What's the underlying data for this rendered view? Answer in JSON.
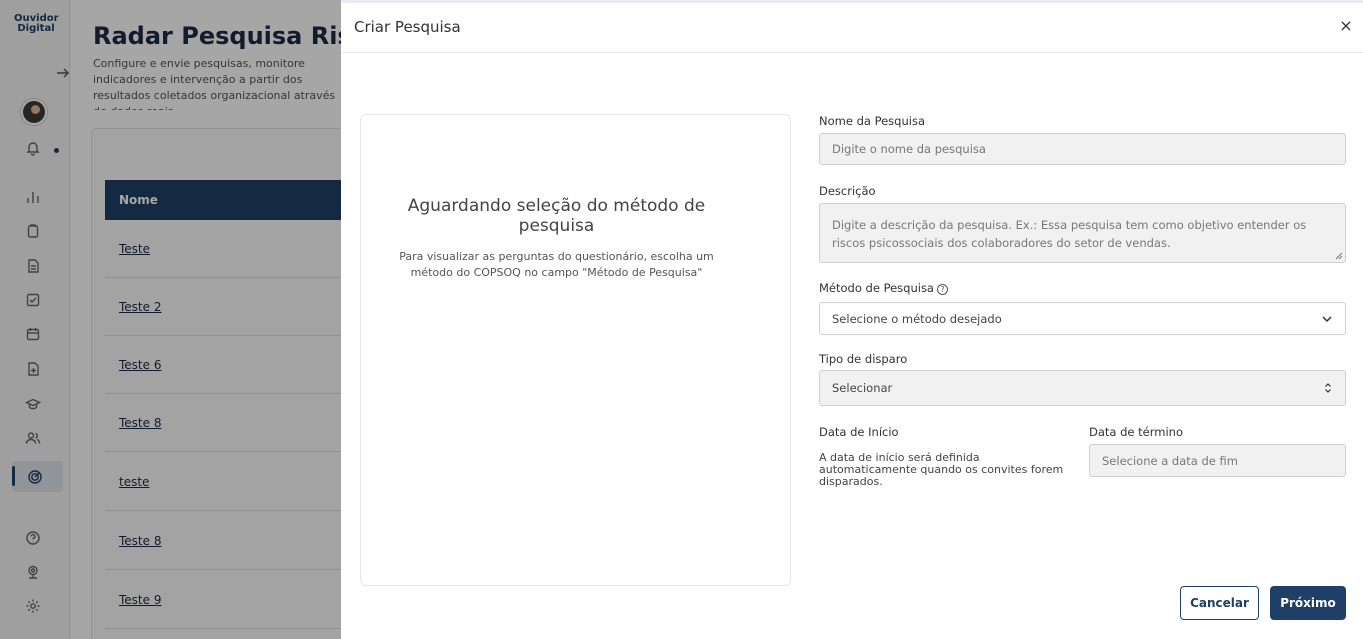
{
  "sidebar": {
    "logo_line1": "Ouvidor",
    "logo_line2": "Digital"
  },
  "main": {
    "title": "Radar Pesquisa Riscos",
    "subtitle": "Configure e envie pesquisas, monitore indicadores e intervenção a partir dos resultados coletados organizacional através de dados reais.",
    "table": {
      "header": "Nome",
      "rows": [
        "Teste",
        "Teste 2",
        "Teste 6",
        "Teste 8",
        "teste",
        "Teste 8",
        "Teste 9"
      ]
    }
  },
  "dialog": {
    "title": "Criar Pesquisa",
    "close_symbol": "×",
    "preview": {
      "title": "Aguardando seleção do método de pesquisa",
      "text": "Para visualizar as perguntas do questionário, escolha um método do COPSOQ no campo \"Método de Pesquisa\""
    },
    "form": {
      "name_label": "Nome da Pesquisa",
      "name_placeholder": "Digite o nome da pesquisa",
      "desc_label": "Descrição",
      "desc_placeholder": "Digite a descrição da pesquisa. Ex.: Essa pesquisa tem como objetivo entender os riscos psicossociais dos colaboradores do setor de vendas.",
      "method_label": "Método de Pesquisa",
      "method_placeholder": "Selecione o método desejado",
      "trigger_label": "Tipo de disparo",
      "trigger_placeholder": "Selecionar",
      "start_label": "Data de Início",
      "start_hint": "A data de início será definida automaticamente quando os convites forem disparados.",
      "end_label": "Data de término",
      "end_placeholder": "Selecione a data de fim"
    },
    "buttons": {
      "cancel": "Cancelar",
      "next": "Próximo"
    }
  }
}
